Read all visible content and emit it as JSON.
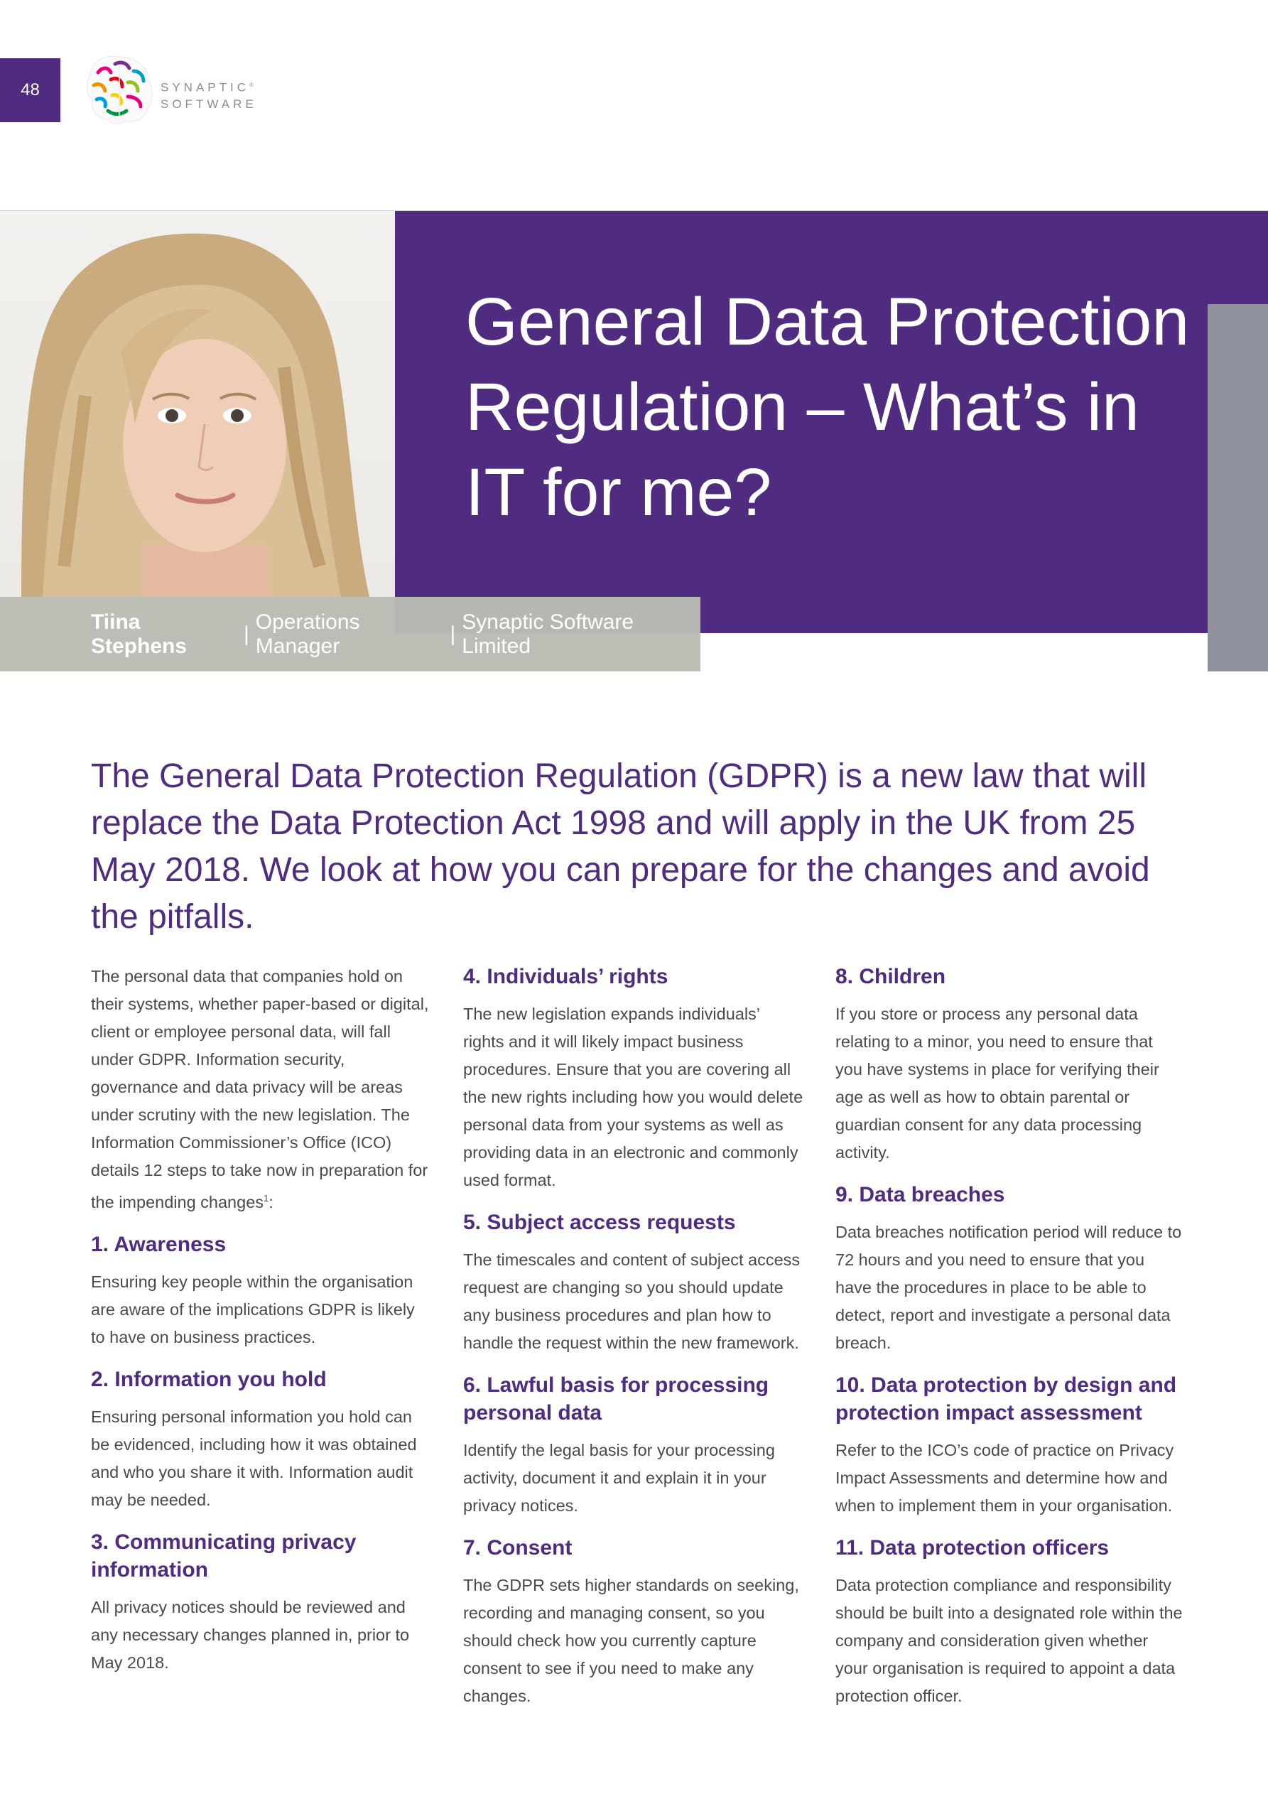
{
  "page_number": "48",
  "logo": {
    "line1": "SYNAPTIC",
    "mark": "®",
    "line2": "SOFTWARE",
    "icon": "brain-icon"
  },
  "title": "General Data Protection Regulation – What’s in IT for me?",
  "byline": {
    "name": "Tiina Stephens",
    "role": "Operations Manager",
    "company": "Synaptic Software Limited",
    "separator": "|"
  },
  "standfirst": "The General Data Protection Regulation (GDPR) is a new law that will replace the Data Protection Act 1998 and will apply in the UK from 25 May 2018. We look at how you can prepare for the changes and avoid the pitfalls.",
  "intro": {
    "text": "The personal data that companies hold on their systems, whether paper-based or digital, client or employee personal data, will fall under GDPR. Information security, governance and data privacy will be areas under scrutiny with the new legislation. The Information Commissioner’s Office (ICO) details 12 steps to take now in preparation for the impending changes",
    "footnote": "1",
    "suffix": ":"
  },
  "sections": [
    {
      "heading": "1. Awareness",
      "body": "Ensuring key people within the organisation are aware of the implications GDPR is likely to have on business practices."
    },
    {
      "heading": "2. Information you hold",
      "body": "Ensuring personal information you hold can be evidenced, including how it was obtained and who you share it with. Information audit may be needed."
    },
    {
      "heading": "3. Communicating privacy information",
      "body": "All privacy notices should be reviewed and any necessary changes planned in, prior to May 2018."
    },
    {
      "heading": "4. Individuals’ rights",
      "body": "The new legislation expands individuals’ rights and it will likely impact business procedures. Ensure that you are covering all the new rights including how you would delete personal data from your systems as well as providing data in an electronic and commonly used format."
    },
    {
      "heading": "5. Subject access requests",
      "body": "The timescales and content of subject access request are changing so you should update any business procedures and plan how to handle the request within the new framework."
    },
    {
      "heading": "6. Lawful basis for processing personal data",
      "body": "Identify the legal basis for your processing activity, document it and explain it in your privacy notices."
    },
    {
      "heading": "7. Consent",
      "body": "The GDPR sets higher standards on seeking, recording and managing consent, so you should check how you currently capture consent to see if you need to make any changes."
    },
    {
      "heading": "8. Children",
      "body": "If you store or process any personal data relating to a minor, you need to ensure that you have systems in place for verifying their age as well as how to obtain parental or guardian consent for any data processing activity."
    },
    {
      "heading": "9. Data breaches",
      "body": "Data breaches notification period will reduce to 72 hours and you need to ensure that you have the procedures in place to be able to detect, report and investigate a personal data breach."
    },
    {
      "heading": "10. Data protection by design and protection impact assessment",
      "body": "Refer to the ICO’s code of practice on Privacy Impact Assessments and determine how and when to implement them in your organisation."
    },
    {
      "heading": "11. Data protection officers",
      "body": "Data protection compliance and responsibility should be built into a designated role within the company and consideration given whether your organisation is required to appoint a data protection officer."
    }
  ],
  "colors": {
    "purple": "#4f2c80",
    "grey_tab": "#8f919c",
    "byline_bg": "#babcb4"
  }
}
